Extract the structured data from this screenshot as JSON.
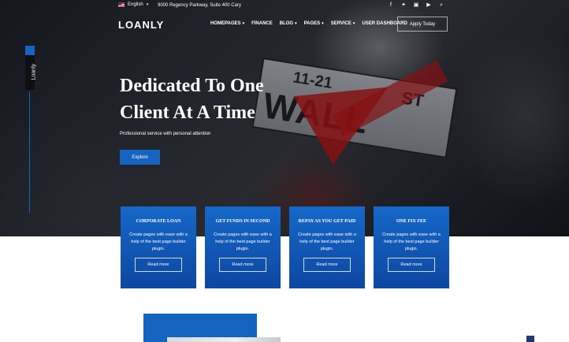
{
  "topbar": {
    "language": "English",
    "address": "9000 Regency Parkway, Suite 400 Cary",
    "social_icons": [
      "facebook-icon",
      "twitter-icon",
      "linkedin-icon",
      "youtube-icon",
      "search-icon"
    ]
  },
  "header": {
    "logo": "LOANLY",
    "nav": [
      {
        "label": "HOMEPAGES",
        "dropdown": true
      },
      {
        "label": "FINANCE",
        "dropdown": false
      },
      {
        "label": "BLOG",
        "dropdown": true
      },
      {
        "label": "PAGES",
        "dropdown": true
      },
      {
        "label": "SERVICE",
        "dropdown": true
      },
      {
        "label": "USER DASHBOARD",
        "dropdown": false
      }
    ],
    "apply_label": "Apply Today"
  },
  "side_tab": {
    "label": "Loanly"
  },
  "hero": {
    "title_line1": "Dedicated To One",
    "title_line2": "Client At A Time",
    "subtitle": "Professional service with personal attention",
    "button_label": "Explore",
    "sign_top": "11-21",
    "sign_main": "WALL",
    "sign_st": "ST"
  },
  "cards": [
    {
      "title": "CORPORATE LOAN",
      "text": "Create pages with ease with a help of the best page builder plugin.",
      "button": "Read more"
    },
    {
      "title": "GET FUNDS IN SECOND",
      "text": "Create pages with ease with a help of the best page builder plugin.",
      "button": "Read more"
    },
    {
      "title": "REPAY AS YOU GET PAID",
      "text": "Create pages with ease with a help of the best page builder plugin.",
      "button": "Read more"
    },
    {
      "title": "ONE FIX FEE",
      "text": "Create pages with ease with a help of the best page builder plugin.",
      "button": "Read more"
    }
  ],
  "colors": {
    "accent": "#1565c0",
    "card_gradient_top": "#1668c9",
    "card_gradient_bottom": "#0d47a1"
  }
}
